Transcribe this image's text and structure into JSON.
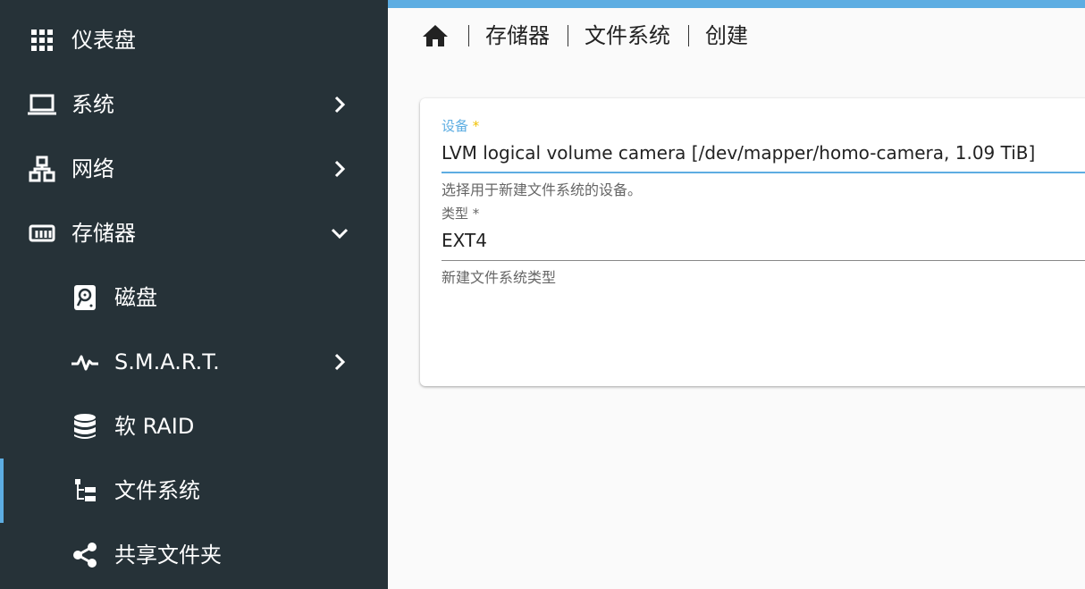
{
  "sidebar": {
    "items": [
      {
        "label": "仪表盘",
        "icon": "dashboard-grid-icon"
      },
      {
        "label": "系统",
        "icon": "laptop-icon",
        "chevron": "chevron-right-icon"
      },
      {
        "label": "网络",
        "icon": "network-icon",
        "chevron": "chevron-right-icon"
      },
      {
        "label": "存储器",
        "icon": "storage-icon",
        "chevron": "chevron-down-icon"
      },
      {
        "label": "磁盘",
        "icon": "harddisk-icon"
      },
      {
        "label": "S.M.A.R.T.",
        "icon": "pulse-icon",
        "chevron": "chevron-right-icon"
      },
      {
        "label": "软 RAID",
        "icon": "database-icon"
      },
      {
        "label": "文件系统",
        "icon": "file-tree-icon"
      },
      {
        "label": "共享文件夹",
        "icon": "share-icon"
      }
    ],
    "active_item": "文件系统"
  },
  "breadcrumb": {
    "home_icon": "home-icon",
    "items": [
      "存储器",
      "文件系统",
      "创建"
    ]
  },
  "form": {
    "device": {
      "label": "设备",
      "required_mark": "*",
      "value": "LVM logical volume camera [/dev/mapper/homo-camera, 1.09 TiB]",
      "hint": "选择用于新建文件系统的设备。"
    },
    "type": {
      "label": "类型",
      "required_mark": "*",
      "value": "EXT4",
      "hint": "新建文件系统类型"
    }
  },
  "colors": {
    "sidebar_bg": "#263238",
    "accent": "#5dade2",
    "required": "#f0c000",
    "page_bg": "#fafafa"
  }
}
